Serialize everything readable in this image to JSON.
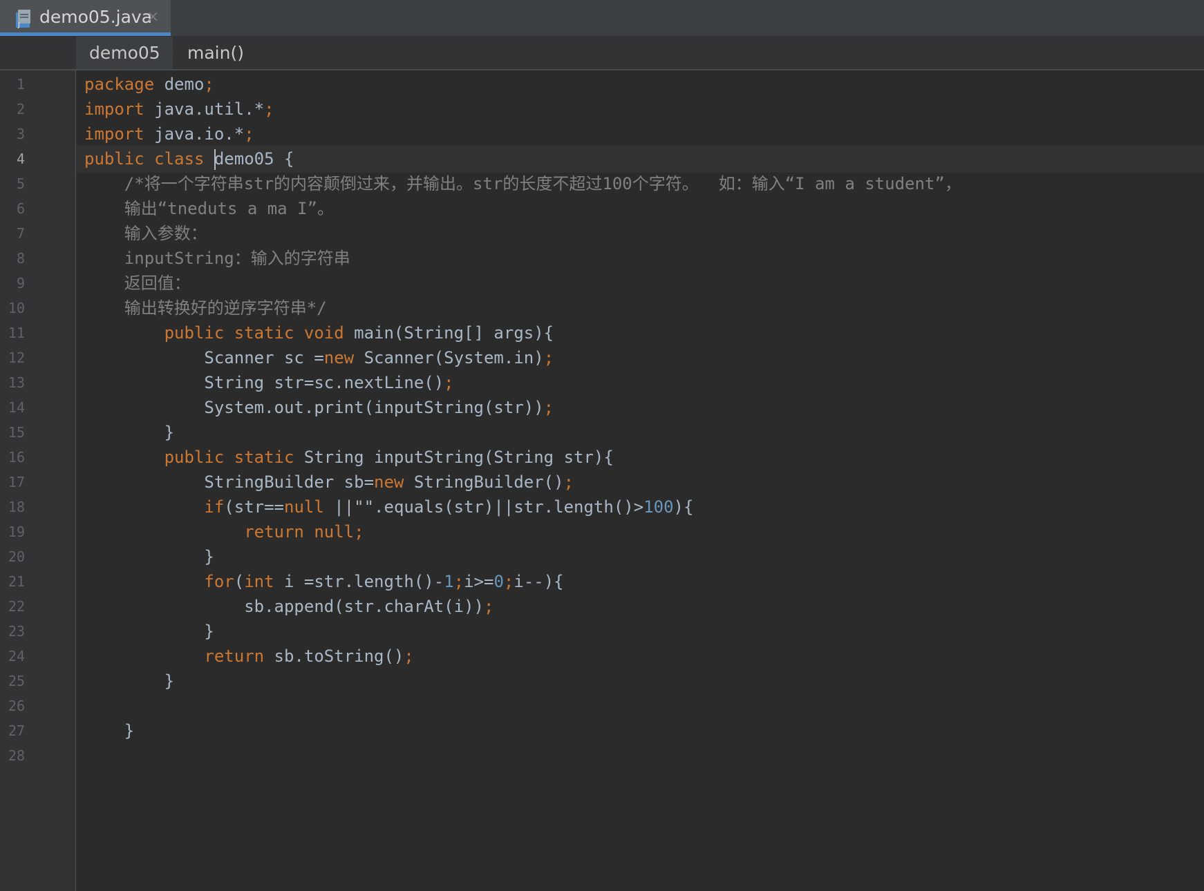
{
  "tab": {
    "label": "demo05.java",
    "close": "×"
  },
  "breadcrumb": {
    "items": [
      "demo05",
      "main()"
    ]
  },
  "gutter": {
    "line_numbers": [
      "1",
      "2",
      "3",
      "4",
      "5",
      "6",
      "7",
      "8",
      "9",
      "10",
      "11",
      "12",
      "13",
      "14",
      "15",
      "16",
      "17",
      "18",
      "19",
      "20",
      "21",
      "22",
      "23",
      "24",
      "25",
      "26",
      "27",
      "28"
    ],
    "current_line": 4
  },
  "code": {
    "line1": [
      "package",
      " demo",
      ";"
    ],
    "line2": [
      "import",
      " java.util.*",
      ";"
    ],
    "line3": [
      "import",
      " java.io.*",
      ";"
    ],
    "line4": [
      "public class ",
      "demo05 {"
    ],
    "line5": "    /*将一个字符串str的内容颠倒过来，并输出。str的长度不超过100个字符。  如：输入“I am a student”，",
    "line6": "    输出“tneduts a ma I”。",
    "line7": "    输入参数：",
    "line8": "    inputString：输入的字符串",
    "line9": "    返回值：",
    "line10": "    输出转换好的逆序字符串*/",
    "line11": [
      "        ",
      "public static void",
      " main(String[] args){"
    ],
    "line12": [
      "            Scanner sc =",
      "new",
      " Scanner(System.in)",
      ";"
    ],
    "line13": [
      "            String str=sc.nextLine()",
      ";"
    ],
    "line14": [
      "            System.out.print(inputString(str))",
      ";"
    ],
    "line15": "        }",
    "line16": [
      "        ",
      "public static",
      " String inputString(String str){"
    ],
    "line17": [
      "            StringBuilder sb=",
      "new",
      " StringBuilder()",
      ";"
    ],
    "line18": [
      "            ",
      "if",
      "(str==",
      "null",
      " ||\"\".equals(str)||str.length()>",
      "100",
      "){"
    ],
    "line19": [
      "                ",
      "return null;"
    ],
    "line20": "            }",
    "line21": [
      "            ",
      "for",
      "(",
      "int",
      " i =str.length()-",
      "1",
      ";",
      "i>=",
      "0",
      ";",
      "i--){"
    ],
    "line22": [
      "                sb.append(str.charAt(i))",
      ";"
    ],
    "line23": "            }",
    "line24": [
      "            ",
      "return",
      " sb.toString()",
      ";"
    ],
    "line25": "        }",
    "line26": "",
    "line27": "    }",
    "line28": ""
  },
  "colors": {
    "keyword": "#cc7832",
    "identifier": "#a9b7c6",
    "number": "#6897bb",
    "comment": "#808080",
    "tab_accent": "#4a88c7"
  },
  "icons": {
    "tab_file": "java-file-icon"
  }
}
